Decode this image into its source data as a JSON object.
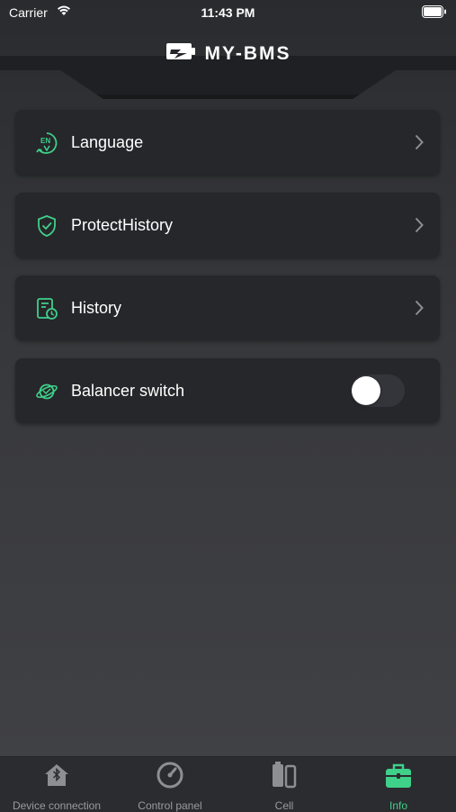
{
  "status_bar": {
    "carrier": "Carrier",
    "time": "11:43 PM"
  },
  "header": {
    "title": "MY-BMS"
  },
  "menu": [
    {
      "label": "Language",
      "icon": "language-en-icon",
      "action": "chevron-right-icon"
    },
    {
      "label": "ProtectHistory",
      "icon": "shield-check-icon",
      "action": "chevron-right-icon"
    },
    {
      "label": "History",
      "icon": "history-document-clock-icon",
      "action": "chevron-right-icon"
    },
    {
      "label": "Balancer switch",
      "icon": "balance-planet-icon",
      "toggle_on": false
    }
  ],
  "tabs": [
    {
      "label": "Device connection",
      "icon": "bluetooth-home-icon",
      "active": false
    },
    {
      "label": "Control panel",
      "icon": "gauge-icon",
      "active": false
    },
    {
      "label": "Cell",
      "icon": "battery-cell-icon",
      "active": false
    },
    {
      "label": "Info",
      "icon": "briefcase-info-icon",
      "active": true
    }
  ],
  "colors": {
    "accent": "#3fd08a",
    "card": "#26272a",
    "inactive": "#9a9b9e"
  }
}
